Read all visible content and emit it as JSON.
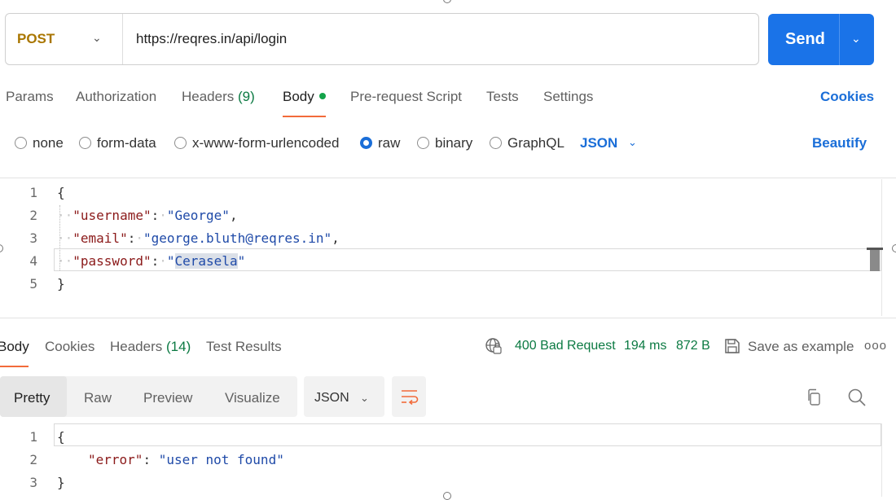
{
  "request": {
    "method": "POST",
    "url": "https://reqres.in/api/login",
    "send_label": "Send"
  },
  "request_tabs": {
    "params": "Params",
    "authorization": "Authorization",
    "headers": "Headers",
    "headers_count": "(9)",
    "body": "Body",
    "pre_request": "Pre-request Script",
    "tests": "Tests",
    "settings": "Settings",
    "cookies": "Cookies"
  },
  "body_types": {
    "none": "none",
    "form_data": "form-data",
    "urlencoded": "x-www-form-urlencoded",
    "raw": "raw",
    "binary": "binary",
    "graphql": "GraphQL",
    "selected": "raw",
    "language": "JSON",
    "beautify": "Beautify"
  },
  "request_body": {
    "line_numbers": [
      "1",
      "2",
      "3",
      "4",
      "5"
    ],
    "open_brace": "{",
    "close_brace": "}",
    "fields": [
      {
        "key": "\"username\"",
        "value": "\"George\"",
        "trailing": ","
      },
      {
        "key": "\"email\"",
        "value": "\"george.bluth@reqres.in\"",
        "trailing": ","
      },
      {
        "key": "\"password\"",
        "value_pre": "\"",
        "value_selected": "Cerasela",
        "value_post": "\""
      }
    ]
  },
  "response_tabs": {
    "body": "Body",
    "cookies": "Cookies",
    "headers": "Headers",
    "headers_count": "(14)",
    "test_results": "Test Results"
  },
  "response_meta": {
    "status": "400 Bad Request",
    "time": "194 ms",
    "size": "872 B",
    "save_example": "Save as example",
    "more": "ooo"
  },
  "response_view": {
    "pretty": "Pretty",
    "raw": "Raw",
    "preview": "Preview",
    "visualize": "Visualize",
    "format": "JSON"
  },
  "response_body": {
    "line_numbers": [
      "1",
      "2",
      "3"
    ],
    "open_brace": "{",
    "close_brace": "}",
    "key": "\"error\"",
    "value": "\"user not found\""
  },
  "colors": {
    "accent_blue": "#1a73e8",
    "method_post": "#a97600",
    "status_green": "#0c7a43",
    "tab_underline": "#f26b3a"
  }
}
